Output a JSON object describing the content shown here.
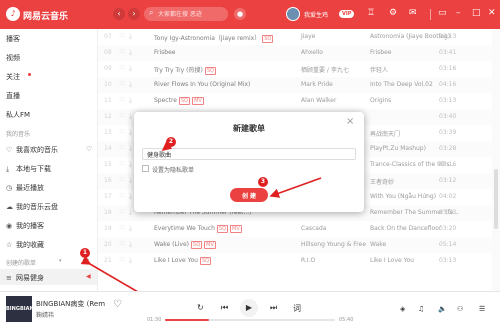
{
  "app": {
    "title": "网易云音乐"
  },
  "search": {
    "placeholder": "大家都在搜 恶迹"
  },
  "user": {
    "name": "我爱生鸡",
    "vip": "VIP"
  },
  "colors": {
    "brand": "#ec4141"
  },
  "sidebar": {
    "items": [
      {
        "label": "播客"
      },
      {
        "label": "视频"
      },
      {
        "label": "关注"
      },
      {
        "label": "直播"
      },
      {
        "label": "私人FM"
      }
    ],
    "my_music_title": "我的音乐",
    "my_music": [
      {
        "label": "我喜欢的音乐",
        "icon": "heart-icon"
      },
      {
        "label": "本地与下载",
        "icon": "download-icon"
      },
      {
        "label": "最近播放",
        "icon": "clock-icon"
      },
      {
        "label": "我的音乐云盘",
        "icon": "cloud-icon"
      },
      {
        "label": "我的播客",
        "icon": "podcast-icon"
      },
      {
        "label": "我的收藏",
        "icon": "star-icon"
      }
    ],
    "created_title": "创建的歌单",
    "playlist": "网易健身"
  },
  "songs": [
    {
      "num": "07",
      "title": "Tony Igy-Astronomia（Jiaye remix）",
      "tag": "SQ",
      "artist": "Jiaye",
      "album": "Astronomia (Jiaye Bootleg)",
      "duration": "03:13"
    },
    {
      "num": "08",
      "title": "Frisbee",
      "tag": "",
      "artist": "Ahxello",
      "album": "Frisbee",
      "duration": "03:41"
    },
    {
      "num": "09",
      "title": "Try Try Try (热搜)",
      "tag": "SQ",
      "artist": "栖顾重要 / 李九七",
      "album": "伴轻人",
      "duration": "03:16"
    },
    {
      "num": "10",
      "title": "River Flows In You (Original Mix)",
      "tag": "",
      "artist": "Mark Pride",
      "album": "Into The Deep Vol.02",
      "duration": "04:16"
    },
    {
      "num": "11",
      "title": "Spectre",
      "tag": "SQ",
      "tag2": "MV",
      "artist": "Alan Walker",
      "album": "Origins",
      "duration": "03:13"
    },
    {
      "num": "12",
      "title": "",
      "tag": "",
      "artist": "",
      "album": "",
      "duration": "03:40"
    },
    {
      "num": "13",
      "title": "",
      "tag": "",
      "artist": "",
      "album": "再战南天门",
      "duration": "03:39"
    },
    {
      "num": "14",
      "title": "",
      "tag": "",
      "artist": "",
      "album": "PlayPt.Zu Mashup)",
      "duration": "03:28"
    },
    {
      "num": "15",
      "title": "",
      "tag": "",
      "artist": "",
      "album": "Trance-Classics of the 90's...",
      "duration": "03:16"
    },
    {
      "num": "16",
      "title": "",
      "tag": "",
      "artist": "",
      "album": "王者奇妙",
      "duration": "03:12"
    },
    {
      "num": "17",
      "title": "",
      "tag": "",
      "artist": "",
      "album": "With You (Ngẫu Hứng)",
      "duration": "04:02"
    },
    {
      "num": "18",
      "title": "Remember The Summer (feat...)",
      "tag": "",
      "artist": "",
      "album": "Remember The Summer (fe...",
      "duration": "03:33"
    },
    {
      "num": "19",
      "title": "Everytime We Touch",
      "tag": "SQ",
      "tag2": "MV",
      "artist": "Cascada",
      "album": "Back On the Dancefloor",
      "duration": "03:20"
    },
    {
      "num": "20",
      "title": "Wake (Live)",
      "tag": "SQ",
      "tag2": "MV",
      "artist": "Hillsong Young & Free",
      "album": "Wake",
      "duration": "05:14"
    },
    {
      "num": "21",
      "title": "Like I Love You",
      "tag": "SQ",
      "artist": "R.I.O",
      "album": "Like I Love You",
      "duration": "03:13"
    }
  ],
  "dialog": {
    "title": "新建歌单",
    "input_value": "健身歌曲",
    "checkbox_label": "设置为隐私歌单",
    "create_label": "创 建"
  },
  "annotations": [
    "1",
    "2",
    "3"
  ],
  "player": {
    "cover_text": "BINGBIAN",
    "title": "BINGBIAN病变 (Rem",
    "artist": "鞠婧祎",
    "current": "01:30",
    "total": "05:40",
    "progress": 0.26
  }
}
